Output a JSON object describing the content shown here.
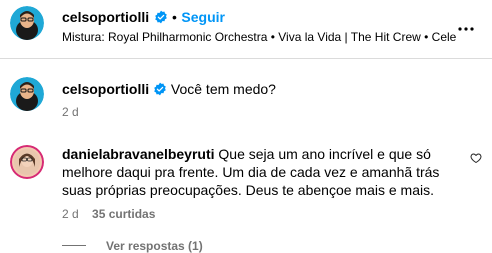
{
  "post_header": {
    "username": "celsoportiolli",
    "separator": "•",
    "follow_label": "Seguir",
    "audio_line": "Mistura: Royal Philharmonic Orchestra • Viva la Vida | The Hit Crew • Cele",
    "more_icon": "more-horizontal-icon"
  },
  "caption": {
    "username": "celsoportiolli",
    "text": "Você tem medo?",
    "time": "2 d"
  },
  "comment": {
    "username": "danielabravanelbeyruti",
    "line1_text": "Que seja um ano incrível e que só",
    "line2": "melhore daqui pra frente. Um dia de cada vez e amanhã trás",
    "line3": "suas próprias preocupações. Deus te abençoe mais e mais.",
    "time": "2 d",
    "likes": "35 curtidas",
    "view_replies": "Ver respostas (1)",
    "like_icon": "heart-outline-icon"
  },
  "colors": {
    "accent": "#0095f6",
    "verified": "#0095f6",
    "muted": "#737373",
    "divider": "#dbdbdb"
  }
}
